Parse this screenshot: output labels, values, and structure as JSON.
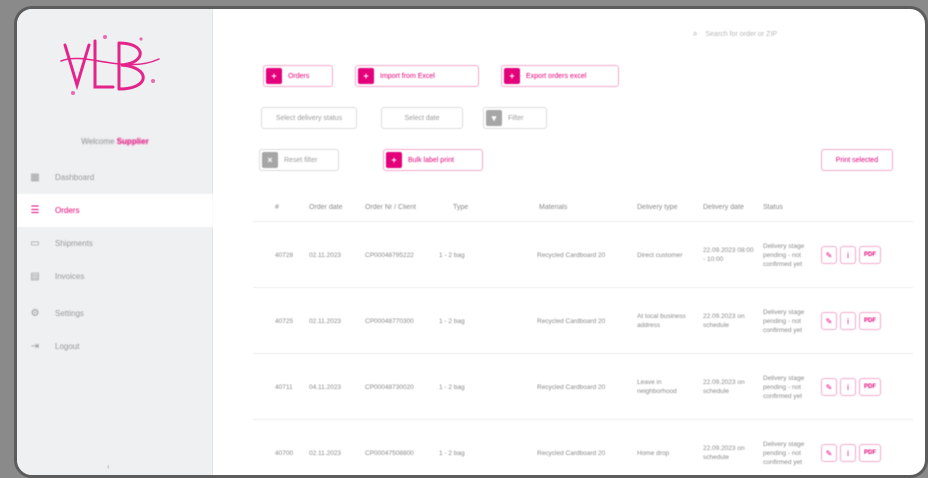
{
  "sidebar": {
    "logo_text": "VLB",
    "welcome_prefix": "Welcome",
    "user_name": "Supplier",
    "items": [
      {
        "label": "Dashboard",
        "icon": "dashboard-icon",
        "glyph": "▦"
      },
      {
        "label": "Orders",
        "icon": "orders-icon",
        "glyph": "☰"
      },
      {
        "label": "Shipments",
        "icon": "truck-icon",
        "glyph": "▭"
      },
      {
        "label": "Invoices",
        "icon": "invoice-icon",
        "glyph": "▤"
      },
      {
        "label": "Settings",
        "icon": "gear-icon",
        "glyph": "⚙"
      },
      {
        "label": "Logout",
        "icon": "logout-icon",
        "glyph": "⇥"
      }
    ],
    "collapse_glyph": "‹"
  },
  "search": {
    "icon_glyph": "⌕",
    "placeholder": "Search for order or ZIP"
  },
  "toolbar": {
    "add_label": "Orders",
    "import_label": "Import from Excel",
    "export_label": "Export orders excel",
    "filter1_label": "Select delivery status",
    "filter2_label": "Select date",
    "filter_btn_label": "Filter",
    "group_label": "Reset filter",
    "bulk_label": "Bulk label print",
    "right_label": "Print selected"
  },
  "table": {
    "headers": [
      "#",
      "Order date",
      "Order Nr / Client",
      "Type",
      "Materials",
      "Delivery type",
      "Delivery date",
      "Status"
    ],
    "rows": [
      {
        "id": "40728",
        "date": "02.11.2023",
        "order": "CP00048795222",
        "type": "1 - 2 bag",
        "material": "Recycled Cardboard 20",
        "delivery": "Direct customer",
        "deliv_date": "22.09.2023 08:00 - 10:00",
        "status": "Delivery stage pending - not confirmed yet"
      },
      {
        "id": "40725",
        "date": "02.11.2023",
        "order": "CP00048770300",
        "type": "1 - 2 bag",
        "material": "Recycled Cardboard 20",
        "delivery": "At local business address",
        "deliv_date": "22.09.2023 on schedule",
        "status": "Delivery stage pending - not confirmed yet"
      },
      {
        "id": "40711",
        "date": "04.11.2023",
        "order": "CP00048730020",
        "type": "1 - 2 bag",
        "material": "Recycled Cardboard 20",
        "delivery": "Leave in neighborhood",
        "deliv_date": "22.09.2023 on schedule",
        "status": "Delivery stage pending - not confirmed yet"
      },
      {
        "id": "40700",
        "date": "02.11.2023",
        "order": "CP00047508800",
        "type": "1 - 2 bag",
        "material": "Recycled Cardboard 20",
        "delivery": "Home drop",
        "deliv_date": "22.09.2023 on schedule",
        "status": "Delivery stage pending - not confirmed yet"
      }
    ]
  },
  "colors": {
    "accent": "#e3007a",
    "sidebar_bg": "#eef0f1"
  }
}
